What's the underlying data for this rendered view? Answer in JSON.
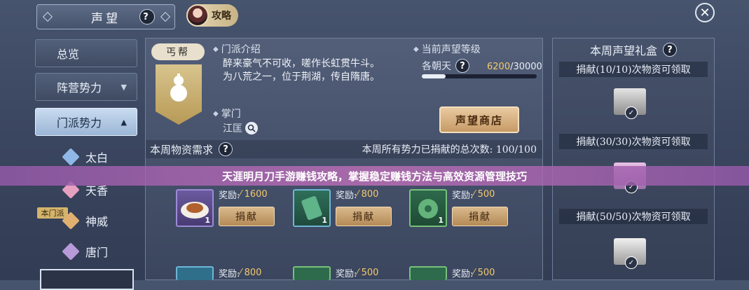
{
  "header": {
    "title": "声望",
    "help": "?",
    "guide_label": "攻略",
    "close": "✕"
  },
  "nav": {
    "items": [
      {
        "label": "总览",
        "arrow": ""
      },
      {
        "label": "阵营势力",
        "arrow": "▼"
      },
      {
        "label": "门派势力",
        "arrow": "▲"
      }
    ],
    "sub_items": [
      {
        "label": "太白",
        "color": "#8fb8e6"
      },
      {
        "label": "天香",
        "color": "#e6a0c0"
      },
      {
        "label": "神威",
        "color": "#e0b070"
      },
      {
        "label": "唐门",
        "color": "#b79ad8"
      }
    ],
    "self_tag": "本门派"
  },
  "sect": {
    "name": "丐帮",
    "intro_label": "门派介绍",
    "intro_text": [
      "醉来豪气不可收，嗟作长虹贯牛斗。",
      "为八荒之一，位于荆湖，传自隋唐。"
    ],
    "leader_label": "掌门",
    "leader_name": "江匡"
  },
  "reputation": {
    "label": "当前声望等级",
    "level": "各朝天",
    "current": "6200",
    "max": "/30000",
    "progress": 0.2067,
    "shop_button": "声望商店"
  },
  "weekly": {
    "title": "本周物资需求",
    "total_label": "本周所有势力已捐献的总次数: 100/100"
  },
  "items": [
    {
      "reward_label": "奖励:",
      "reward": "1600",
      "qty": "1",
      "button": "捐献",
      "rarity_color": "#9d8bd6"
    },
    {
      "reward_label": "奖励:",
      "reward": "800",
      "qty": "1",
      "button": "捐献",
      "rarity_color": "#6fb6d8"
    },
    {
      "reward_label": "奖励:",
      "reward": "500",
      "qty": "1",
      "button": "捐献",
      "rarity_color": "#76c27a"
    },
    {
      "reward_label": "奖励:",
      "reward": "800",
      "qty": "",
      "button": "",
      "rarity_color": "#6fb6d8"
    },
    {
      "reward_label": "奖励:",
      "reward": "500",
      "qty": "",
      "button": "",
      "rarity_color": "#76c27a"
    },
    {
      "reward_label": "奖励:",
      "reward": "500",
      "qty": "",
      "button": "",
      "rarity_color": "#76c27a"
    }
  ],
  "gifts": {
    "title": "本周声望礼盒",
    "tiers": [
      {
        "label": "捐献(10/10)次物资可领取"
      },
      {
        "label": "捐献(30/30)次物资可领取"
      },
      {
        "label": "捐献(50/50)次物资可领取"
      }
    ]
  },
  "overlay_text": "天涯明月刀手游赚钱攻略，掌握稳定赚钱方法与高效资源管理技巧"
}
